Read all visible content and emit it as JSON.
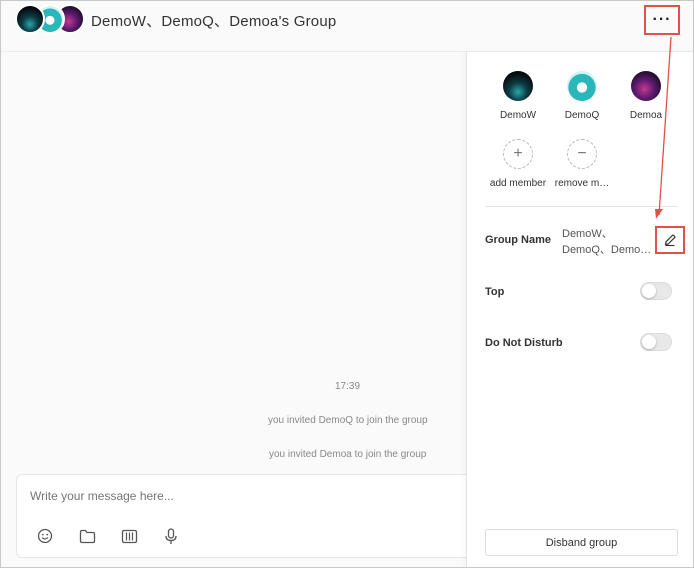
{
  "header": {
    "title": "DemoW、DemoQ、Demoa's Group",
    "more_label": "···"
  },
  "chat": {
    "timestamp": "17:39",
    "messages": [
      "you invited DemoQ to join the group",
      "you invited Demoa to join the group"
    ]
  },
  "composer": {
    "placeholder": "Write your message here...",
    "tools": [
      "emoji-icon",
      "folder-icon",
      "image-icon",
      "microphone-icon"
    ]
  },
  "panel": {
    "members": [
      {
        "name": "DemoW"
      },
      {
        "name": "DemoQ"
      },
      {
        "name": "Demoa"
      }
    ],
    "add_member_label": "add member",
    "remove_member_label": "remove m…",
    "group_name_label": "Group Name",
    "group_name_value": "DemoW、\nDemoQ、Demo…",
    "top_label": "Top",
    "dnd_label": "Do Not Disturb",
    "disband_label": "Disband group"
  },
  "colors": {
    "annotation": "#e0524a"
  }
}
